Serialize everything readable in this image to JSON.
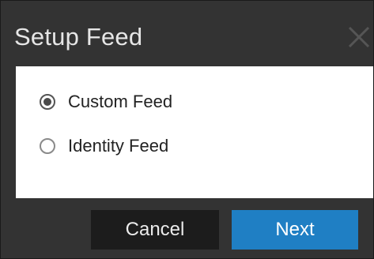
{
  "dialog": {
    "title": "Setup Feed",
    "close_icon": "close-icon",
    "options": [
      {
        "label": "Custom Feed",
        "selected": true
      },
      {
        "label": "Identity Feed",
        "selected": false
      }
    ],
    "buttons": {
      "cancel_label": "Cancel",
      "next_label": "Next"
    },
    "colors": {
      "background": "#333333",
      "accent": "#1f7fc4",
      "cancel_bg": "#1c1c1c"
    }
  }
}
